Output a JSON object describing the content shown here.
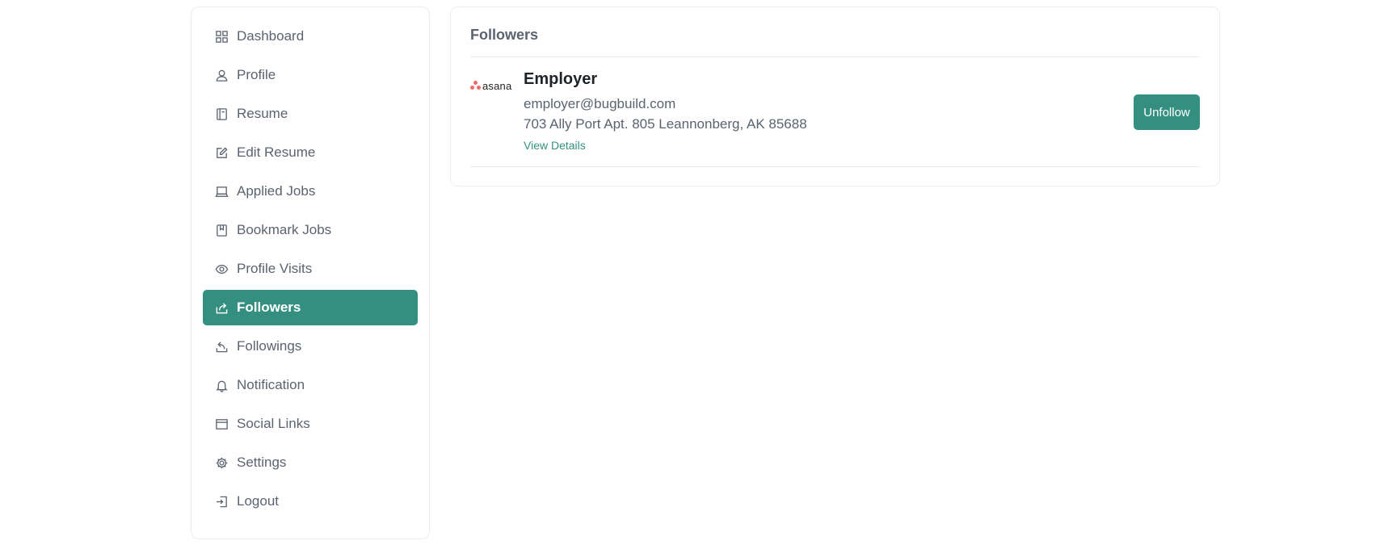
{
  "sidebar": {
    "items": [
      {
        "label": "Dashboard",
        "icon": "dashboard-icon"
      },
      {
        "label": "Profile",
        "icon": "user-icon"
      },
      {
        "label": "Resume",
        "icon": "document-icon"
      },
      {
        "label": "Edit Resume",
        "icon": "edit-icon"
      },
      {
        "label": "Applied Jobs",
        "icon": "laptop-icon"
      },
      {
        "label": "Bookmark Jobs",
        "icon": "bookmark-icon"
      },
      {
        "label": "Profile Visits",
        "icon": "eye-icon"
      },
      {
        "label": "Followers",
        "icon": "share-icon",
        "active": true
      },
      {
        "label": "Followings",
        "icon": "share-back-icon"
      },
      {
        "label": "Notification",
        "icon": "bell-icon"
      },
      {
        "label": "Social Links",
        "icon": "browser-icon"
      },
      {
        "label": "Settings",
        "icon": "gear-icon"
      },
      {
        "label": "Logout",
        "icon": "logout-icon"
      }
    ]
  },
  "main": {
    "title": "Followers",
    "followers": [
      {
        "logo_text": "asana",
        "name": "Employer",
        "email": "employer@bugbuild.com",
        "address": "703 Ally Port Apt. 805 Leannonberg, AK 85688",
        "details_label": "View Details",
        "action_label": "Unfollow"
      }
    ]
  },
  "colors": {
    "accent": "#358f80",
    "logo": "#f06a6a"
  }
}
